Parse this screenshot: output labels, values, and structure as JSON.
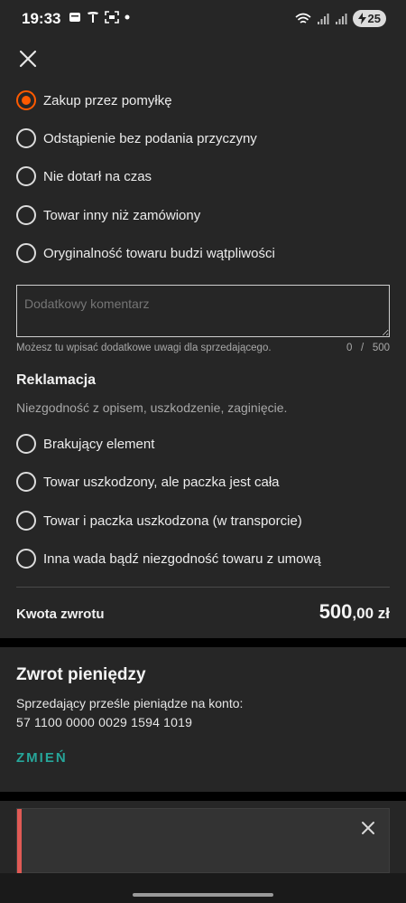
{
  "status_bar": {
    "time": "19:33",
    "battery": "25",
    "left_icons": [
      "notification-icon",
      "tesla-icon",
      "screenshot-icon",
      "dot-icon"
    ],
    "right_icons": [
      "wifi-icon",
      "signal-icon",
      "signal-icon",
      "battery-charging-icon"
    ]
  },
  "return_reasons": [
    {
      "label": "Zakup przez pomyłkę",
      "checked": true
    },
    {
      "label": "Odstąpienie bez podania przyczyny",
      "checked": false
    },
    {
      "label": "Nie dotarł na czas",
      "checked": false
    },
    {
      "label": "Towar inny niż zamówiony",
      "checked": false
    },
    {
      "label": "Oryginalność towaru budzi wątpliwości",
      "checked": false
    }
  ],
  "comment": {
    "placeholder": "Dodatkowy komentarz",
    "value": "",
    "hint": "Możesz tu wpisać dodatkowe uwagi dla sprzedającego.",
    "count": "0",
    "separator": "/",
    "max": "500"
  },
  "complaint": {
    "title": "Reklamacja",
    "subtitle": "Niezgodność z opisem, uszkodzenie, zaginięcie.",
    "options": [
      {
        "label": "Brakujący element",
        "checked": false
      },
      {
        "label": "Towar uszkodzony, ale paczka jest cała",
        "checked": false
      },
      {
        "label": "Towar i paczka uszkodzona (w transporcie)",
        "checked": false
      },
      {
        "label": "Inna wada bądź niezgodność towaru z umową",
        "checked": false
      }
    ]
  },
  "refund_amount": {
    "label": "Kwota zwrotu",
    "value_main": "500",
    "value_decimal": ",00 zł"
  },
  "refund_method": {
    "title": "Zwrot pieniędzy",
    "description": "Sprzedający prześle pieniądze na konto:",
    "account": "57 1100 0000 0029 1594 1019",
    "change_label": "ZMIEŃ"
  },
  "colors": {
    "accent": "#ff5a00",
    "link": "#26a69a",
    "alert": "#e05a55"
  }
}
